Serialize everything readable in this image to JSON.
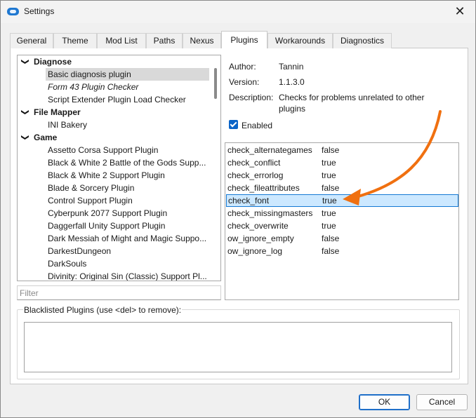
{
  "window": {
    "title": "Settings",
    "close_glyph": "✕"
  },
  "tabs": [
    {
      "label": "General"
    },
    {
      "label": "Theme"
    },
    {
      "label": "Mod List"
    },
    {
      "label": "Paths"
    },
    {
      "label": "Nexus"
    },
    {
      "label": "Plugins",
      "active": true
    },
    {
      "label": "Workarounds"
    },
    {
      "label": "Diagnostics"
    }
  ],
  "plugin_tree": {
    "groups": [
      {
        "label": "Diagnose",
        "items": [
          "Basic diagnosis plugin",
          "Form 43 Plugin Checker",
          "Script Extender Plugin Load Checker"
        ]
      },
      {
        "label": "File Mapper",
        "items": [
          "INI Bakery"
        ]
      },
      {
        "label": "Game",
        "items": [
          "Assetto Corsa Support Plugin",
          "Black & White 2 Battle of the Gods Supp...",
          "Black & White 2 Support Plugin",
          "Blade & Sorcery Plugin",
          "Control Support Plugin",
          "Cyberpunk 2077 Support Plugin",
          "Daggerfall Unity Support Plugin",
          "Dark Messiah of Might and Magic Suppo...",
          "DarkestDungeon",
          "DarkSouls",
          "Divinity: Original Sin (Classic) Support Pl..."
        ]
      }
    ],
    "selected_item": "Basic diagnosis plugin",
    "italic_item": "Form 43 Plugin Checker",
    "expand_glyph": "❯"
  },
  "filter": {
    "placeholder": "Filter",
    "value": ""
  },
  "details": {
    "author_label": "Author:",
    "author": "Tannin",
    "version_label": "Version:",
    "version": "1.1.3.0",
    "description_label": "Description:",
    "description": "Checks for problems unrelated to other plugins",
    "enabled_label": "Enabled",
    "enabled": true
  },
  "settings": [
    {
      "key": "check_alternategames",
      "value": "false"
    },
    {
      "key": "check_conflict",
      "value": "true"
    },
    {
      "key": "check_errorlog",
      "value": "true"
    },
    {
      "key": "check_fileattributes",
      "value": "false"
    },
    {
      "key": "check_font",
      "value": "true",
      "selected": true
    },
    {
      "key": "check_missingmasters",
      "value": "true"
    },
    {
      "key": "check_overwrite",
      "value": "true"
    },
    {
      "key": "ow_ignore_empty",
      "value": "false"
    },
    {
      "key": "ow_ignore_log",
      "value": "false"
    }
  ],
  "blacklist": {
    "label": "Blacklisted Plugins (use <del> to remove):"
  },
  "buttons": {
    "ok": "OK",
    "cancel": "Cancel"
  },
  "colors": {
    "accent": "#1f78d1",
    "selection": "#cce8ff",
    "annotation_arrow": "#f07010"
  }
}
